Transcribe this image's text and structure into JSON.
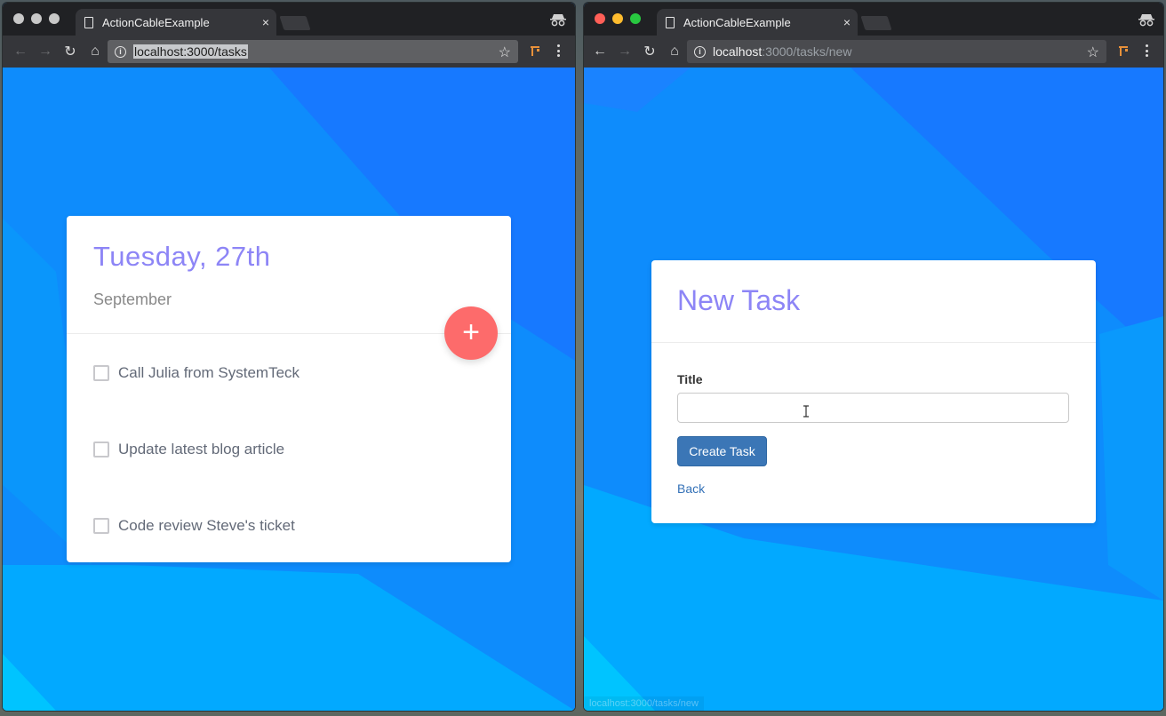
{
  "left_window": {
    "tab_title": "ActionCableExample",
    "tab_close": "×",
    "url": "localhost:3000/tasks",
    "card": {
      "date": "Tuesday, 27th",
      "month": "September",
      "fab_label": "+",
      "tasks": [
        {
          "label": "Call Julia from SystemTeck",
          "checked": false
        },
        {
          "label": "Update latest blog article",
          "checked": false
        },
        {
          "label": "Code review Steve's ticket",
          "checked": false
        }
      ]
    }
  },
  "right_window": {
    "tab_title": "ActionCableExample",
    "tab_close": "×",
    "url_host": "localhost",
    "url_rest": ":3000/tasks/new",
    "form": {
      "title": "New Task",
      "field_label": "Title",
      "field_value": "",
      "submit_label": "Create Task",
      "back_label": "Back"
    },
    "status_bar_url": "localhost:3000/tasks/new"
  },
  "colors": {
    "background_blue": "#0e8cfc",
    "accent_purple": "#8d85f6",
    "fab_red": "#fd6b6b",
    "button_blue": "#3b76b6",
    "link_blue": "#3371b7"
  },
  "icons": [
    "doc-icon",
    "close-icon",
    "incognito-icon",
    "back-arrow-icon",
    "forward-arrow-icon",
    "reload-icon",
    "home-icon",
    "info-icon",
    "star-icon",
    "extension-icon",
    "menu-icon",
    "plus-icon",
    "text-cursor-icon"
  ]
}
